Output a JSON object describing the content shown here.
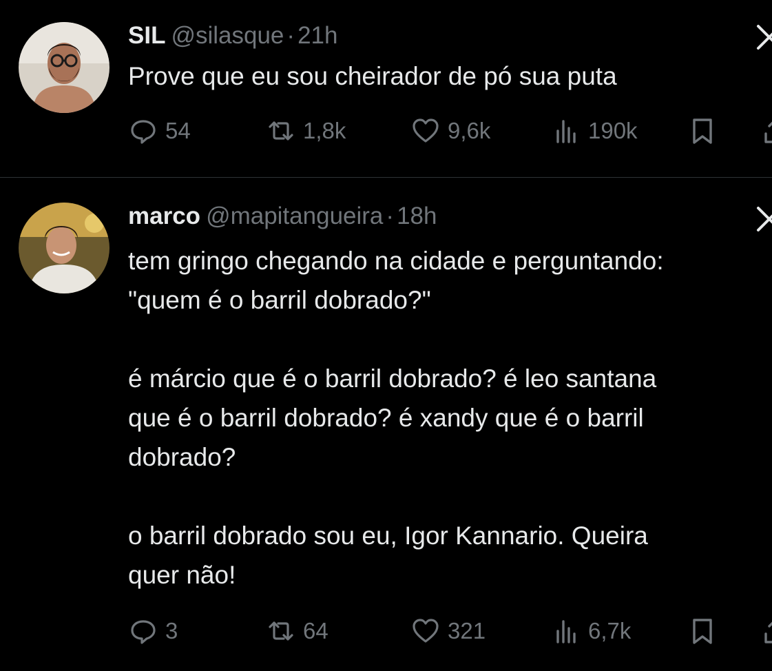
{
  "tweets": [
    {
      "name": "SIL",
      "handle": "@silasque",
      "separator": "·",
      "time": "21h",
      "text": "Prove que eu sou cheirador de pó sua puta",
      "replies": "54",
      "retweets": "1,8k",
      "likes": "9,6k",
      "views": "190k",
      "avatar_icon": "user-avatar-photo"
    },
    {
      "name": "marco",
      "handle": "@mapitangueira",
      "separator": "·",
      "time": "18h",
      "text": "tem gringo chegando na cidade e perguntando:\n\"quem é o barril dobrado?\"\n\né márcio que é o barril dobrado? é leo santana\nque é o barril dobrado? é xandy que é o barril\ndobrado?\n\no barril dobrado sou eu, Igor Kannario. Queira\nquer não!",
      "replies": "3",
      "retweets": "64",
      "likes": "321",
      "views": "6,7k",
      "avatar_icon": "user-avatar-photo"
    }
  ],
  "colors": {
    "background": "#000000",
    "primary_text": "#e7e9ea",
    "secondary_text": "#71767b",
    "divider": "#2f3336"
  },
  "icons": [
    "reply-icon",
    "retweet-icon",
    "like-icon",
    "views-icon",
    "bookmark-icon",
    "share-icon",
    "x-logo-icon"
  ]
}
